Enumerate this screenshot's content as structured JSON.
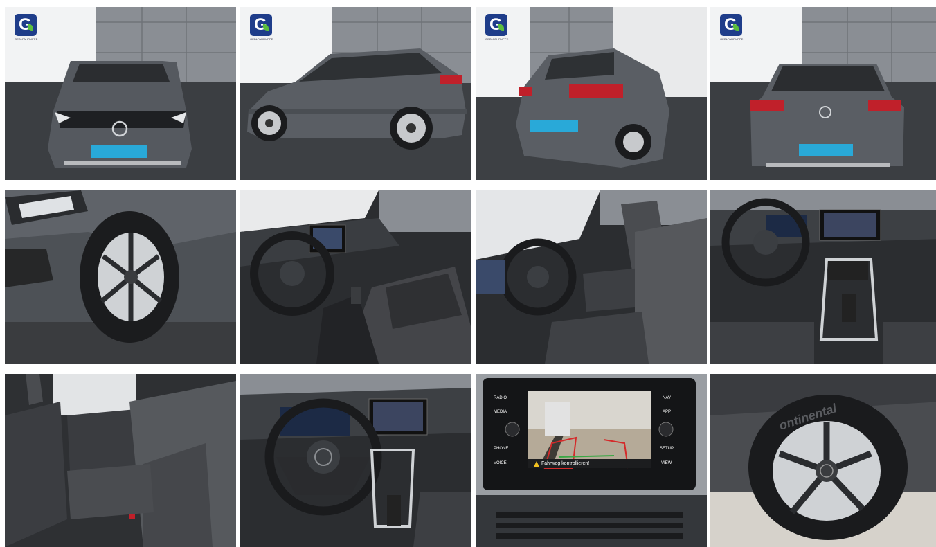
{
  "gallery": {
    "logo": {
      "icon": "dealer-logo-g",
      "text": "GEBLFAHRUPPE",
      "colors": {
        "box": "#1f3d8a",
        "leaf": "#5bbf3d"
      }
    },
    "plate_color": "#29a9d8",
    "car_color": "#595d63",
    "taillight_color": "#c0202a",
    "images": [
      {
        "view": "front"
      },
      {
        "view": "side"
      },
      {
        "view": "rear-quarter"
      },
      {
        "view": "rear"
      },
      {
        "view": "wheel-front-detail"
      },
      {
        "view": "interior-driver"
      },
      {
        "view": "interior-front-seats"
      },
      {
        "view": "dashboard"
      },
      {
        "view": "rear-seats"
      },
      {
        "view": "steering-wheel-cockpit"
      },
      {
        "view": "infotainment-rear-camera"
      },
      {
        "view": "wheel-tire-closeup"
      }
    ],
    "camera_screen": {
      "left_buttons": [
        "RADIO",
        "MEDIA",
        "PHONE",
        "VOICE"
      ],
      "right_buttons": [
        "NAV",
        "APP",
        "SETUP",
        "VIEW"
      ],
      "warning_text": "Fahrweg kontrollieren!"
    },
    "tire_brand_text": "ontinental"
  }
}
